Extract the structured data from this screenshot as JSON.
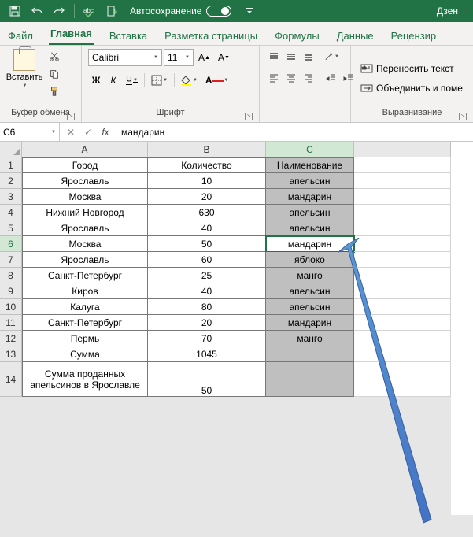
{
  "titlebar": {
    "autosave_label": "Автосохранение",
    "user": "Дзен"
  },
  "tabs": {
    "file": "Файл",
    "home": "Главная",
    "insert": "Вставка",
    "layout": "Разметка страницы",
    "formulas": "Формулы",
    "data": "Данные",
    "review": "Рецензир"
  },
  "ribbon": {
    "clipboard": {
      "paste": "Вставить",
      "group": "Буфер обмена"
    },
    "font": {
      "family": "Calibri",
      "size": "11",
      "group": "Шрифт"
    },
    "align": {
      "wrap": "Переносить текст",
      "merge": "Объединить и поме",
      "group": "Выравнивание"
    }
  },
  "namebox": "C6",
  "formula": "мандарин",
  "cols": {
    "A": "A",
    "B": "B",
    "C": "C"
  },
  "sheet": {
    "headers": {
      "A": "Город",
      "B": "Количество",
      "C": "Наименование"
    },
    "rows": [
      {
        "a": "Ярославль",
        "b": "10",
        "c": "апельсин"
      },
      {
        "a": "Москва",
        "b": "20",
        "c": "мандарин"
      },
      {
        "a": "Нижний Новгород",
        "b": "630",
        "c": "апельсин"
      },
      {
        "a": "Ярославль",
        "b": "40",
        "c": "апельсин"
      },
      {
        "a": "Москва",
        "b": "50",
        "c": "мандарин"
      },
      {
        "a": "Ярославль",
        "b": "60",
        "c": "яблоко"
      },
      {
        "a": "Санкт-Петербург",
        "b": "25",
        "c": "манго"
      },
      {
        "a": "Киров",
        "b": "40",
        "c": "апельсин"
      },
      {
        "a": "Калуга",
        "b": "80",
        "c": "апельсин"
      },
      {
        "a": "Санкт-Петербург",
        "b": "20",
        "c": "мандарин"
      },
      {
        "a": "Пермь",
        "b": "70",
        "c": "манго"
      },
      {
        "a": "Сумма",
        "b": "1045",
        "c": ""
      }
    ],
    "row14": {
      "a": "Сумма проданных апельсинов в Ярославле",
      "b": "50"
    }
  }
}
